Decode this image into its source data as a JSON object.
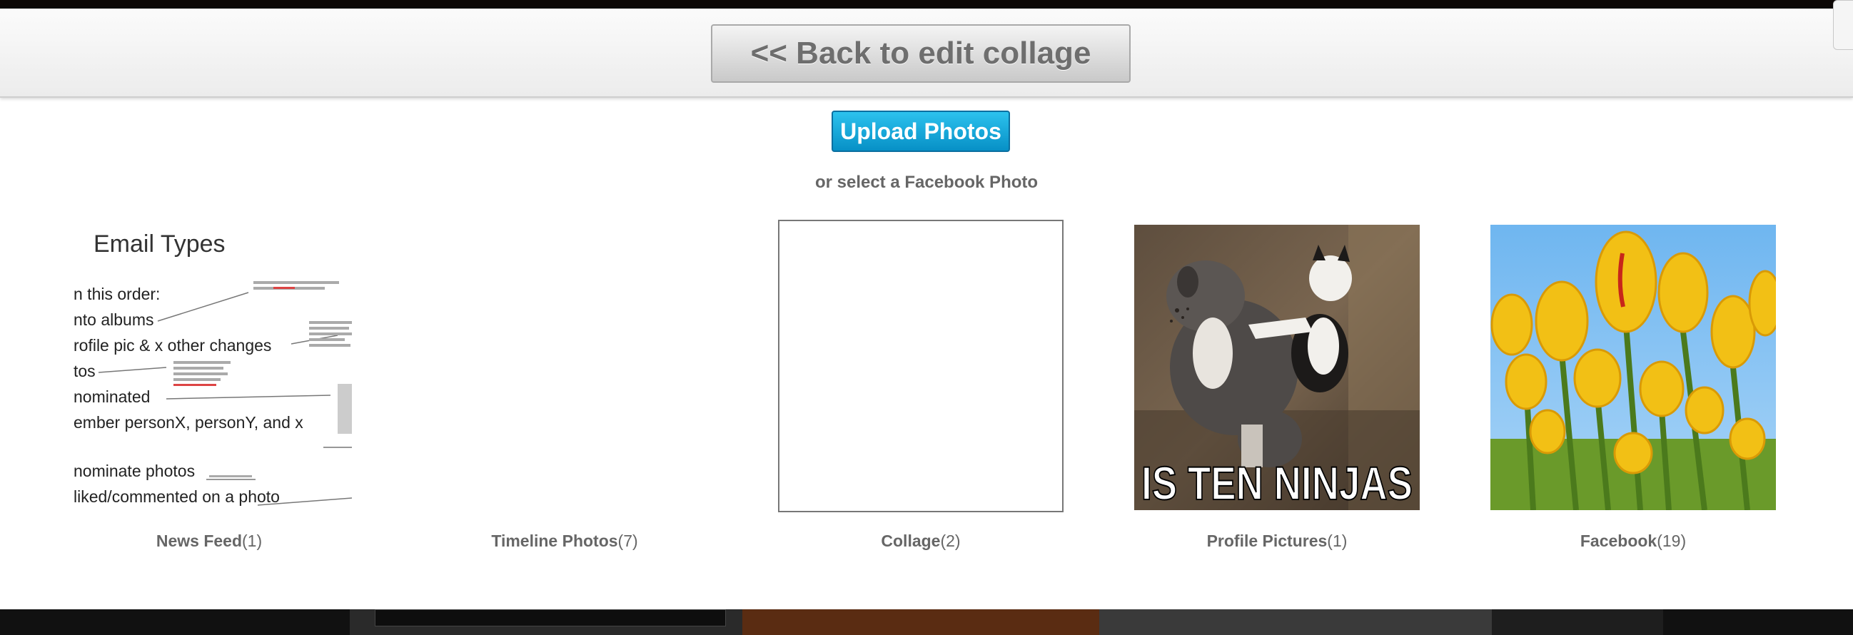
{
  "header": {
    "back_label": "<< Back to edit collage"
  },
  "upload": {
    "label": "Upload Photos"
  },
  "select_prompt": "or select a Facebook Photo",
  "albums": [
    {
      "name": "News Feed",
      "count": "(1)"
    },
    {
      "name": "Timeline Photos",
      "count": "(7)"
    },
    {
      "name": "Collage",
      "count": "(2)"
    },
    {
      "name": "Profile Pictures",
      "count": "(1)"
    },
    {
      "name": "Facebook",
      "count": "(19)"
    }
  ],
  "thumbnails": {
    "news_feed": {
      "title": "Email Types",
      "lines": [
        "n this order:",
        "nto albums",
        "rofile pic & x other changes",
        "tos",
        "nominated",
        "ember personX, personY, and x",
        "nominate photos",
        "liked/commented on a photo"
      ]
    },
    "profile_pictures": {
      "caption": "IS TEN NINJAS"
    }
  },
  "colors": {
    "upload_button": "#0790c6",
    "label_text": "#666666",
    "header_bg": "#ececec"
  }
}
